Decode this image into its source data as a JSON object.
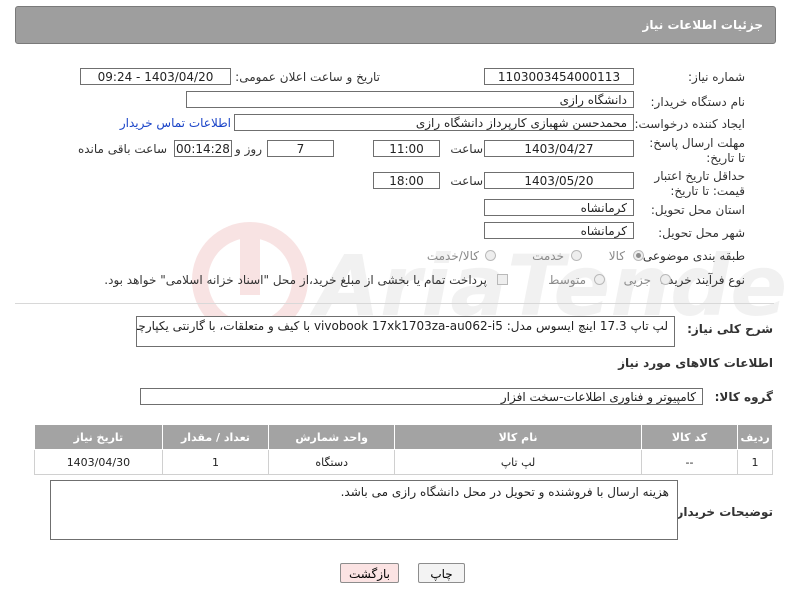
{
  "header": {
    "title": "جزئیات اطلاعات نیاز"
  },
  "fields": {
    "need_number_label": "شماره نیاز:",
    "need_number": "1103003454000113",
    "announce_label": "تاریخ و ساعت اعلان عمومی:",
    "announce_value": "1403/04/20 - 09:24",
    "buyer_org_label": "نام دستگاه خریدار:",
    "buyer_org": "دانشگاه رازی",
    "creator_label": "ایجاد کننده درخواست:",
    "creator": "محمدحسن شهبازی کارپرداز دانشگاه رازی",
    "contact_link": "اطلاعات تماس خریدار",
    "reply_deadline_label": "مهلت ارسال پاسخ: تا تاریخ:",
    "reply_date": "1403/04/27",
    "time_label": "ساعت",
    "reply_time": "11:00",
    "days_value": "7",
    "days_label": "روز و",
    "remaining_time": "00:14:28",
    "remaining_label": "ساعت باقی مانده",
    "validity_label": "حداقل تاریخ اعتبار قیمت: تا تاریخ:",
    "validity_date": "1403/05/20",
    "validity_time": "18:00",
    "province_label": "استان محل تحویل:",
    "province": "کرمانشاه",
    "city_label": "شهر محل تحویل:",
    "city": "کرمانشاه",
    "category_label": "طبقه بندی موضوعی:",
    "category_options": [
      "کالا",
      "خدمت",
      "کالا/خدمت"
    ],
    "process_label": "نوع فرآیند خرید :",
    "process_options": [
      "جزیی",
      "متوسط"
    ],
    "payment_note": "پرداخت تمام یا بخشی از مبلغ خرید،از محل \"اسناد خزانه اسلامی\" خواهد بود.",
    "description_label": "شرح کلی نیاز:",
    "description": "لپ تاپ 17.3 اینچ ایسوس مدل: vivobook 17xk1703za-au062-i5 با کیف و متعلقات، با گارنتی یکپارچه",
    "goods_info_title": "اطلاعات کالاهای مورد نیاز",
    "goods_group_label": "گروه کالا:",
    "goods_group": "کامپیوتر و فناوری اطلاعات-سخت افزار",
    "buyer_notes_label": "توضیحات خریدار:",
    "buyer_notes": "هزینه ارسال با فروشنده و تحویل در محل دانشگاه رازی می باشد."
  },
  "table": {
    "headers": [
      "ردیف",
      "کد کالا",
      "نام کالا",
      "واحد شمارش",
      "تعداد / مقدار",
      "تاریخ نیاز"
    ],
    "rows": [
      [
        "1",
        "--",
        "لپ تاپ",
        "دستگاه",
        "1",
        "1403/04/30"
      ]
    ]
  },
  "buttons": {
    "print": "چاپ",
    "back": "بازگشت"
  },
  "colors": {
    "header_bg": "#9e9e9e",
    "link": "#1a44c8",
    "back_button_bg": "#fbe3e3"
  }
}
